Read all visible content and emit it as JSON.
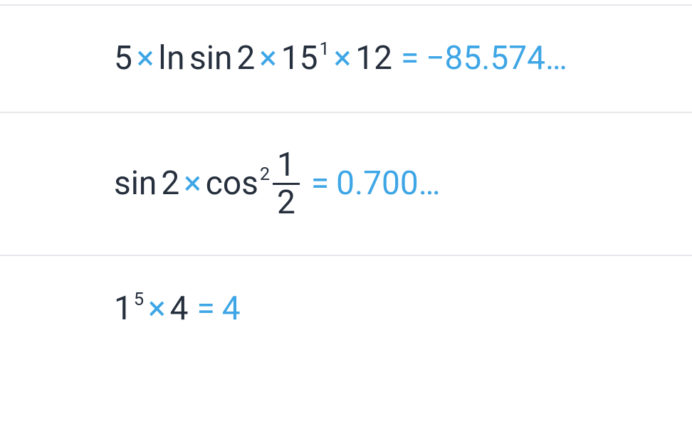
{
  "rows": [
    {
      "a": "5",
      "op1": "×",
      "b": "ln",
      "c": "sin",
      "d": "2",
      "op2": "×",
      "e_base": "15",
      "e_sup": "1",
      "op3": "×",
      "f": "12",
      "eq": "=",
      "result": "−85.574…"
    },
    {
      "a": "sin",
      "b": "2",
      "op1": "×",
      "c": "cos",
      "c_sup": "2",
      "frac_num": "1",
      "frac_den": "2",
      "eq": "=",
      "result": "0.700…"
    },
    {
      "a_base": "1",
      "a_sup": "5",
      "op1": "×",
      "b": "4",
      "eq": "=",
      "result": "4"
    }
  ]
}
